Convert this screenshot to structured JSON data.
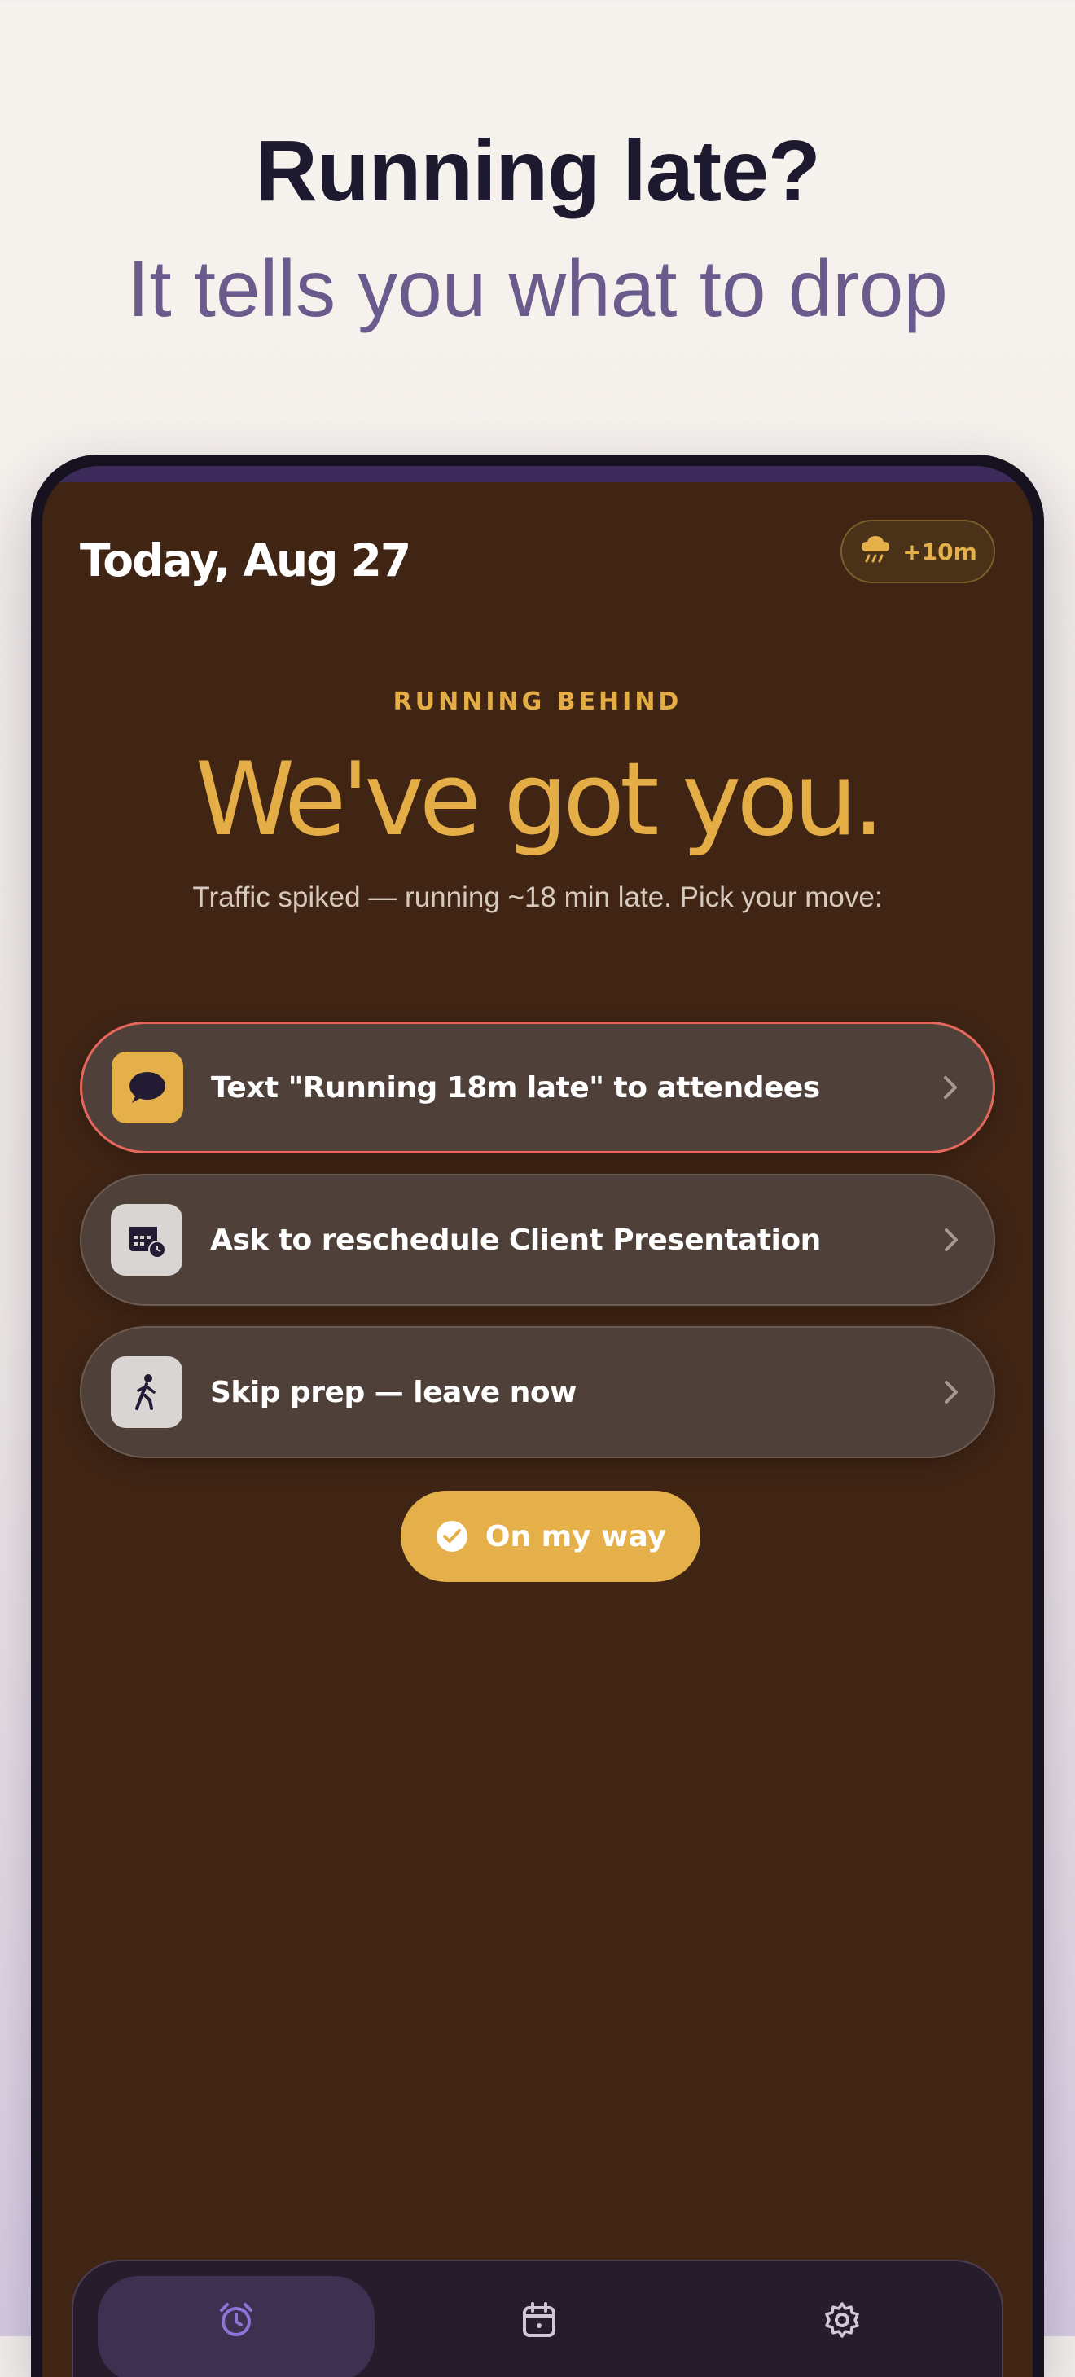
{
  "hero": {
    "title": "Running late?",
    "subtitle": "It tells you what to drop"
  },
  "header": {
    "date": "Today, Aug 27",
    "weather_badge": "+10m",
    "weather_icon": "rain-cloud-icon"
  },
  "status": {
    "eyebrow": "RUNNING BEHIND",
    "headline": "We've got you.",
    "message": "Traffic spiked — running ~18 min late. Pick your move:"
  },
  "options": [
    {
      "label": "Text \"Running 18m late\" to attendees",
      "icon": "chat-bubble-icon"
    },
    {
      "label": "Ask to reschedule Client Presentation",
      "icon": "calendar-clock-icon"
    },
    {
      "label": "Skip prep — leave now",
      "icon": "walking-person-icon"
    }
  ],
  "cta": {
    "label": "On my way",
    "icon": "check-circle-icon"
  },
  "tabbar": {
    "tabs": [
      {
        "icon": "alarm-clock-icon",
        "active": true
      },
      {
        "icon": "calendar-icon",
        "active": false
      },
      {
        "icon": "gear-icon",
        "active": false
      }
    ]
  },
  "colors": {
    "accent": "#e5b04a",
    "screen_bg": "#402515",
    "highlight_border": "#e5675c",
    "active_tab_icon": "#8f74d8"
  }
}
